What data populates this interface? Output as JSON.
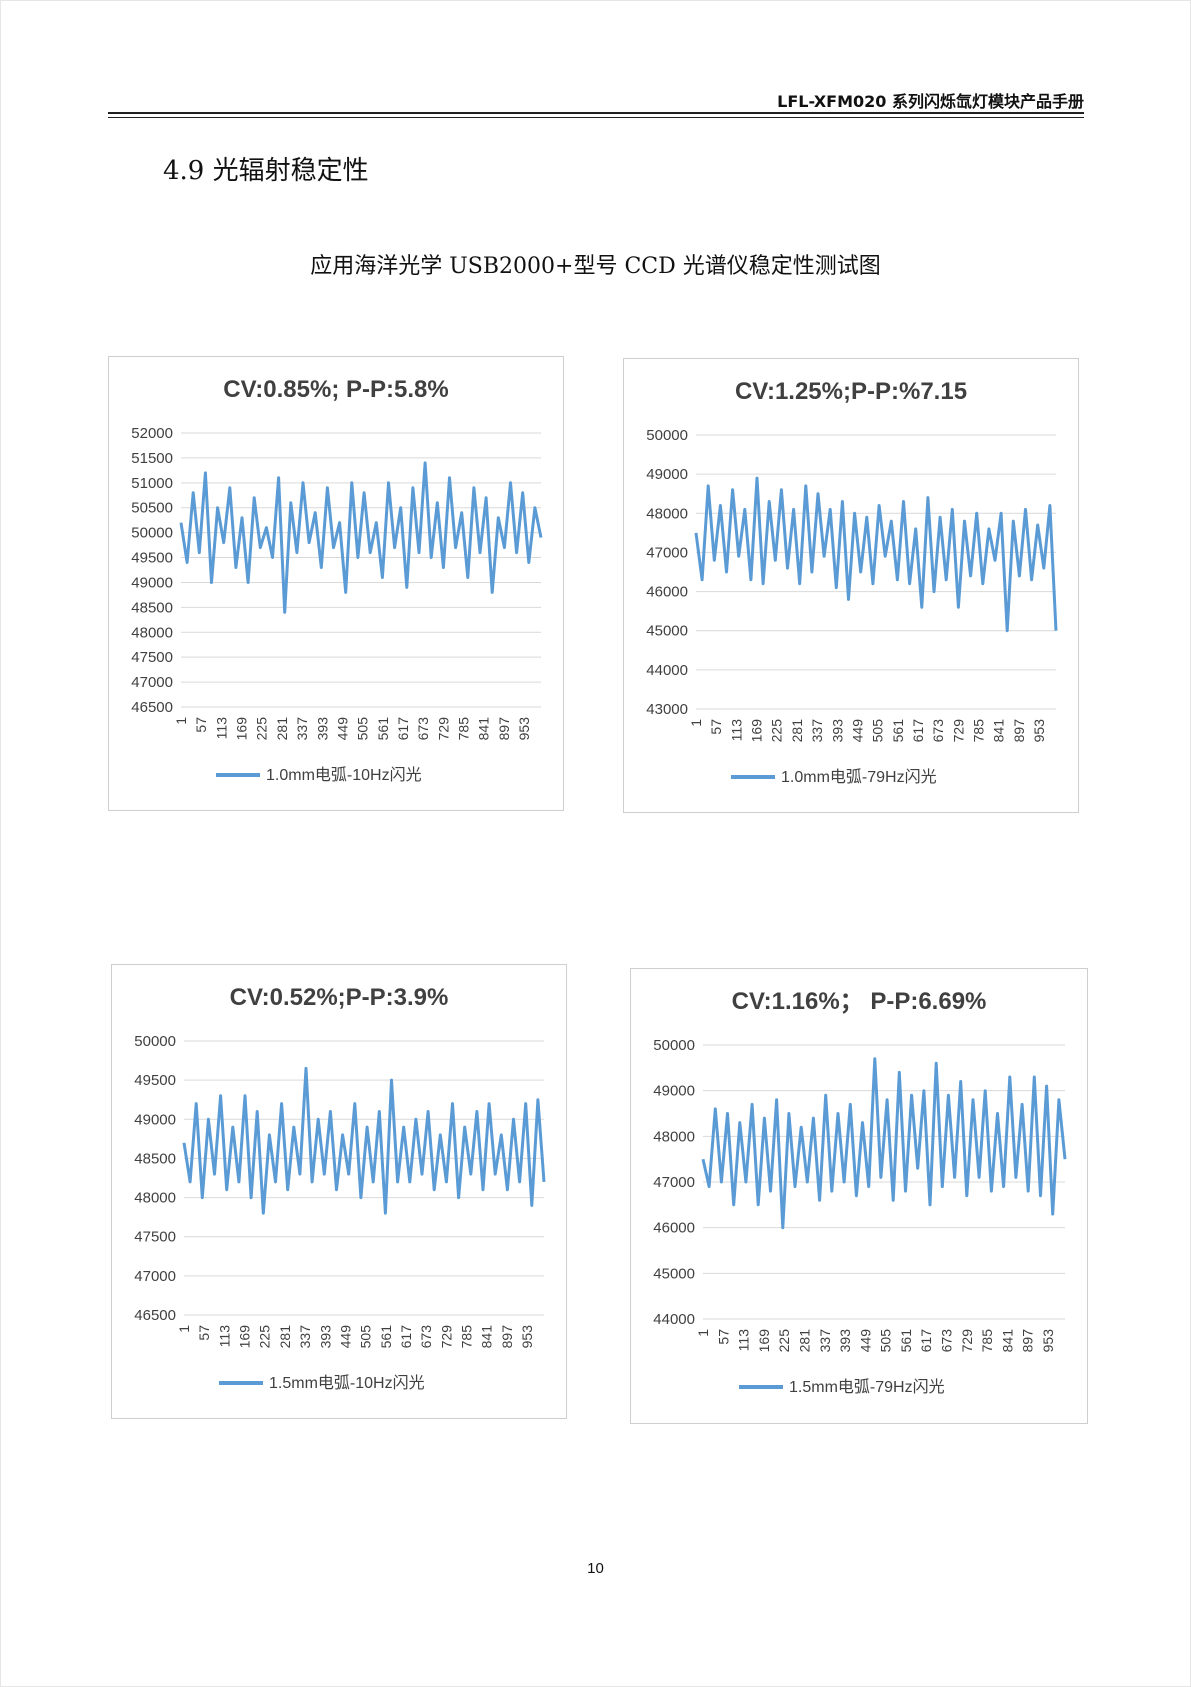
{
  "header": {
    "title": "LFL-XFM020 系列闪烁氙灯模块产品手册"
  },
  "section": {
    "heading": "4.9 光辐射稳定性"
  },
  "figure": {
    "title": "应用海洋光学 USB2000+型号 CCD 光谱仪稳定性测试图"
  },
  "page_number": "10",
  "colors": {
    "series": "#5b9bd5",
    "grid": "#d9d9d9",
    "axis_text": "#404040"
  },
  "chart_data": [
    {
      "type": "line",
      "title": "CV:0.85%; P-P:5.8%",
      "categories": [
        "1",
        "57",
        "113",
        "169",
        "225",
        "281",
        "337",
        "393",
        "449",
        "505",
        "561",
        "617",
        "673",
        "729",
        "785",
        "841",
        "897",
        "953"
      ],
      "x_range": [
        1,
        1000
      ],
      "ylim": [
        46500,
        52000
      ],
      "yticks": [
        46500,
        47000,
        47500,
        48000,
        48500,
        49000,
        49500,
        50000,
        50500,
        51000,
        51500,
        52000
      ],
      "grid": true,
      "legend_position": "bottom",
      "series": [
        {
          "name": "1.0mm电弧-10Hz闪光",
          "values": [
            50200,
            49400,
            50800,
            49600,
            51200,
            49000,
            50500,
            49800,
            50900,
            49300,
            50300,
            49000,
            50700,
            49700,
            50100,
            49500,
            51100,
            48400,
            50600,
            49600,
            51000,
            49800,
            50400,
            49300,
            50900,
            49700,
            50200,
            48800,
            51000,
            49500,
            50800,
            49600,
            50200,
            49100,
            51000,
            49700,
            50500,
            48900,
            50900,
            49600,
            51400,
            49500,
            50600,
            49300,
            51100,
            49700,
            50400,
            49100,
            50900,
            49600,
            50700,
            48800,
            50300,
            49700,
            51000,
            49600,
            50800,
            49400,
            50500,
            49900
          ]
        }
      ]
    },
    {
      "type": "line",
      "title": "CV:1.25%;P-P:%7.15",
      "categories": [
        "1",
        "57",
        "113",
        "169",
        "225",
        "281",
        "337",
        "393",
        "449",
        "505",
        "561",
        "617",
        "673",
        "729",
        "785",
        "841",
        "897",
        "953"
      ],
      "x_range": [
        1,
        1000
      ],
      "ylim": [
        43000,
        50000
      ],
      "yticks": [
        43000,
        44000,
        45000,
        46000,
        47000,
        48000,
        49000,
        50000
      ],
      "grid": true,
      "legend_position": "bottom",
      "series": [
        {
          "name": "1.0mm电弧-79Hz闪光",
          "values": [
            47500,
            46300,
            48700,
            46800,
            48200,
            46500,
            48600,
            46900,
            48100,
            46300,
            48900,
            46200,
            48300,
            46800,
            48600,
            46600,
            48100,
            46200,
            48700,
            46500,
            48500,
            46900,
            48100,
            46100,
            48300,
            45800,
            48000,
            46500,
            47900,
            46200,
            48200,
            46900,
            47800,
            46300,
            48300,
            46200,
            47600,
            45600,
            48400,
            46000,
            47900,
            46300,
            48100,
            45600,
            47800,
            46400,
            48000,
            46200,
            47600,
            46800,
            48000,
            45000,
            47800,
            46400,
            48100,
            46300,
            47700,
            46600,
            48200,
            45000
          ]
        }
      ]
    },
    {
      "type": "line",
      "title": "CV:0.52%;P-P:3.9%",
      "categories": [
        "1",
        "57",
        "113",
        "169",
        "225",
        "281",
        "337",
        "393",
        "449",
        "505",
        "561",
        "617",
        "673",
        "729",
        "785",
        "841",
        "897",
        "953"
      ],
      "x_range": [
        1,
        1000
      ],
      "ylim": [
        46500,
        50000
      ],
      "yticks": [
        46500,
        47000,
        47500,
        48000,
        48500,
        49000,
        49500,
        50000
      ],
      "grid": true,
      "legend_position": "bottom",
      "series": [
        {
          "name": "1.5mm电弧-10Hz闪光",
          "values": [
            48700,
            48200,
            49200,
            48000,
            49000,
            48300,
            49300,
            48100,
            48900,
            48200,
            49300,
            48000,
            49100,
            47800,
            48800,
            48200,
            49200,
            48100,
            48900,
            48300,
            49650,
            48200,
            49000,
            48300,
            49100,
            48100,
            48800,
            48300,
            49200,
            48000,
            48900,
            48200,
            49100,
            47800,
            49500,
            48200,
            48900,
            48200,
            49000,
            48300,
            49100,
            48100,
            48800,
            48200,
            49200,
            48000,
            48900,
            48300,
            49100,
            48100,
            49200,
            48300,
            48800,
            48100,
            49000,
            48200,
            49200,
            47900,
            49250,
            48200
          ]
        }
      ]
    },
    {
      "type": "line",
      "title": "CV:1.16%； P-P:6.69%",
      "categories": [
        "1",
        "57",
        "113",
        "169",
        "225",
        "281",
        "337",
        "393",
        "449",
        "505",
        "561",
        "617",
        "673",
        "729",
        "785",
        "841",
        "897",
        "953"
      ],
      "x_range": [
        1,
        1000
      ],
      "ylim": [
        44000,
        50000
      ],
      "yticks": [
        44000,
        45000,
        46000,
        47000,
        48000,
        49000,
        50000
      ],
      "grid": true,
      "legend_position": "bottom",
      "series": [
        {
          "name": "1.5mm电弧-79Hz闪光",
          "values": [
            47500,
            46900,
            48600,
            47000,
            48500,
            46500,
            48300,
            47000,
            48700,
            46500,
            48400,
            46800,
            48800,
            46000,
            48500,
            46900,
            48200,
            47000,
            48400,
            46600,
            48900,
            46800,
            48500,
            47000,
            48700,
            46700,
            48300,
            46900,
            49700,
            47100,
            48800,
            46600,
            49400,
            46800,
            48900,
            47300,
            49000,
            46500,
            49600,
            46900,
            48900,
            47100,
            49200,
            46700,
            48800,
            47100,
            49000,
            46800,
            48500,
            46900,
            49300,
            47100,
            48700,
            46800,
            49300,
            46700,
            49100,
            46300,
            48800,
            47500
          ]
        }
      ]
    }
  ]
}
